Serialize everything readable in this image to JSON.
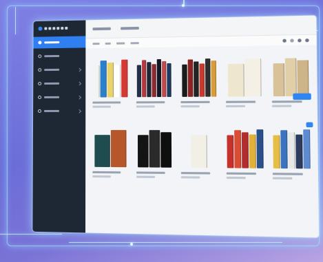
{
  "app": {
    "sidebar": {
      "items": [
        {
          "name": "nav-home",
          "icon": "home-icon",
          "active": true
        },
        {
          "name": "nav-books",
          "icon": "book-icon",
          "active": false
        },
        {
          "name": "nav-categories",
          "icon": "folder-icon",
          "active": false
        },
        {
          "name": "nav-borrow",
          "icon": "swap-icon",
          "active": false
        },
        {
          "name": "nav-users",
          "icon": "user-icon",
          "active": false
        },
        {
          "name": "nav-settings",
          "icon": "gear-icon",
          "active": false
        }
      ]
    },
    "colors": {
      "accent": "#2f7ff0",
      "sidebar_bg": "#1e2734",
      "background_glow": "#7f80e4"
    },
    "books": [
      {
        "name": "book-1",
        "spines": [
          "#f3f3f3",
          "#2c7fc9",
          "#e8d36c",
          "#ffffff",
          "#d33a34"
        ]
      },
      {
        "name": "book-2",
        "spines": [
          "#233047",
          "#b23a3f",
          "#1e2638",
          "#8f2a2f",
          "#101826",
          "#c34a4a",
          "#1f3a5c"
        ]
      },
      {
        "name": "book-3",
        "spines": [
          "#1b1b1b",
          "#8b2323",
          "#242424",
          "#c63a2f",
          "#2d2d2d",
          "#d89c3b"
        ]
      },
      {
        "name": "book-4",
        "spines": [
          "#efe6cf",
          "#f4f0e6"
        ]
      },
      {
        "name": "book-5",
        "spines": [
          "#d8c29a",
          "#e1cfa8",
          "#cdb489"
        ]
      },
      {
        "name": "book-6",
        "spines": [
          "#1f4d4f",
          "#b5562b"
        ]
      },
      {
        "name": "book-7",
        "spines": [
          "#141414",
          "#2a2a2a",
          "#0f0f0f"
        ]
      },
      {
        "name": "book-8",
        "spines": [
          "#f2efe6"
        ]
      },
      {
        "name": "book-9",
        "spines": [
          "#c7312c",
          "#d84d33",
          "#b52c2c",
          "#e1b13c",
          "#2a4f8a"
        ]
      },
      {
        "name": "book-10",
        "spines": [
          "#e6be45",
          "#3b73bf",
          "#e8e8e8",
          "#2d3b5e",
          "#5c8bd1"
        ]
      }
    ]
  }
}
